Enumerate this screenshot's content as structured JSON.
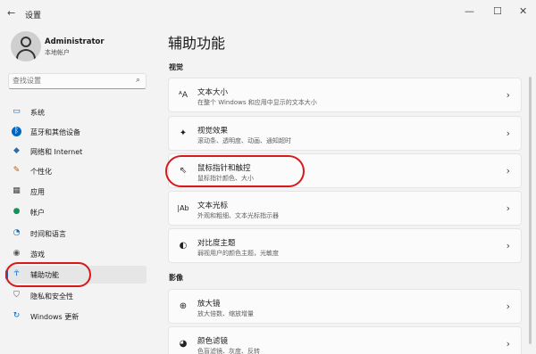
{
  "window": {
    "title": "设置",
    "back_glyph": "←",
    "minimize_glyph": "—",
    "maximize_glyph": "☐",
    "close_glyph": "✕"
  },
  "profile": {
    "name": "Administrator",
    "type": "本地帐户"
  },
  "search": {
    "placeholder": "查找设置",
    "icon": "search-icon",
    "glyph": "⌕"
  },
  "sidebar": {
    "items": [
      {
        "label": "系统",
        "icon": "monitor-icon",
        "glyph": "▭",
        "color": "#0067c0"
      },
      {
        "label": "蓝牙和其他设备",
        "icon": "bluetooth-icon",
        "glyph": "ᛒ",
        "color": "#0067c0"
      },
      {
        "label": "网络和 Internet",
        "icon": "wifi-icon",
        "glyph": "◆",
        "color": "#2b6cb0"
      },
      {
        "label": "个性化",
        "icon": "pencil-icon",
        "glyph": "✎",
        "color": "#c05a00"
      },
      {
        "label": "应用",
        "icon": "apps-icon",
        "glyph": "▦",
        "color": "#444444"
      },
      {
        "label": "帐户",
        "icon": "person-icon",
        "glyph": "●",
        "color": "#1a8f5a"
      },
      {
        "label": "时间和语言",
        "icon": "globe-clock-icon",
        "glyph": "◔",
        "color": "#0067c0"
      },
      {
        "label": "游戏",
        "icon": "gamepad-icon",
        "glyph": "◉",
        "color": "#555555"
      },
      {
        "label": "辅助功能",
        "icon": "accessibility-icon",
        "glyph": "☥",
        "color": "#0067c0",
        "active": true
      },
      {
        "label": "隐私和安全性",
        "icon": "shield-icon",
        "glyph": "⛉",
        "color": "#555555"
      },
      {
        "label": "Windows 更新",
        "icon": "update-icon",
        "glyph": "↻",
        "color": "#0067c0"
      }
    ]
  },
  "main": {
    "heading": "辅助功能",
    "sections": [
      {
        "title": "视觉",
        "cards": [
          {
            "title": "文本大小",
            "desc": "在整个 Windows 和应用中显示的文本大小",
            "icon": "text-size-icon",
            "glyph": "ᴬA"
          },
          {
            "title": "视觉效果",
            "desc": "滚动条、透明度、动画、通知超时",
            "icon": "sparkle-icon",
            "glyph": "✦"
          },
          {
            "title": "鼠标指针和触控",
            "desc": "鼠标指针颜色、大小",
            "icon": "mouse-pointer-icon",
            "glyph": "⇖"
          },
          {
            "title": "文本光标",
            "desc": "外观和粗细、文本光标指示器",
            "icon": "text-cursor-icon",
            "glyph": "|Ab"
          },
          {
            "title": "对比度主题",
            "desc": "弱视用户的颜色主题，光敏度",
            "icon": "contrast-icon",
            "glyph": "◐"
          }
        ]
      },
      {
        "title": "影像",
        "cards": [
          {
            "title": "放大镜",
            "desc": "放大倍数、缩放增量",
            "icon": "magnifier-icon",
            "glyph": "⊕"
          },
          {
            "title": "颜色滤镜",
            "desc": "色盲滤镜、灰度、反转",
            "icon": "color-filter-icon",
            "glyph": "◕"
          }
        ]
      }
    ]
  },
  "chevron_glyph": "›",
  "colors": {
    "accent": "#0067c0",
    "annotation": "#d7191c"
  }
}
